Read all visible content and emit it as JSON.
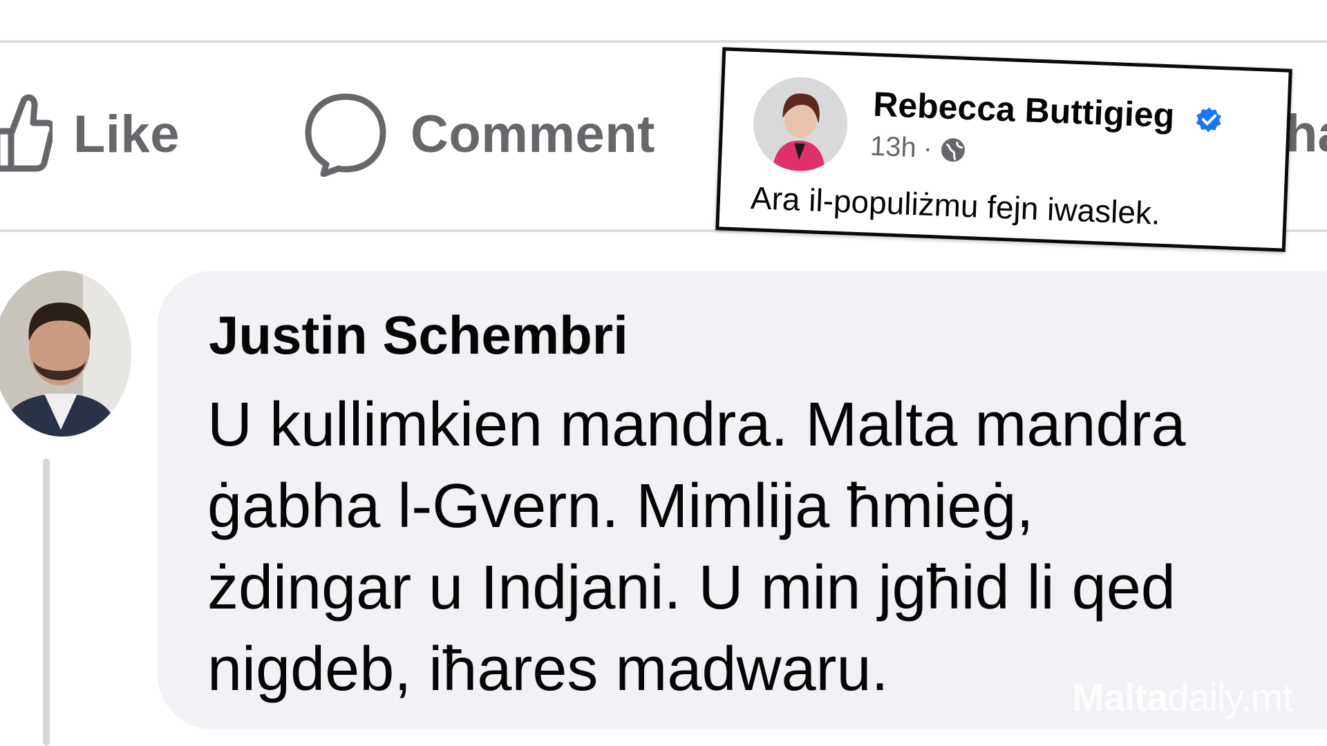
{
  "actions": {
    "like": "Like",
    "comment": "Comment",
    "share_partial": "ha"
  },
  "inset_post": {
    "author": "Rebecca Buttigieg",
    "time": "13h",
    "separator": "·",
    "text": "Ara il-populiżmu fejn iwaslek.",
    "verified_color": "#1877f2",
    "icons": [
      "verified-badge-icon",
      "globe-icon"
    ]
  },
  "comment": {
    "author": "Justin Schembri",
    "text": "U kullimkien mandra. Malta mandra\nġabha l-Gvern. Mimlija ħmieġ,\nżdingar u Indjani. U min jgħid li qed\nnigdeb, iħares madwaru."
  },
  "watermark": {
    "brand": "Malta",
    "rest": "daily.mt"
  },
  "colors": {
    "action_gray": "#65676b",
    "bubble_bg": "#f0f2f5",
    "text": "#050505"
  }
}
